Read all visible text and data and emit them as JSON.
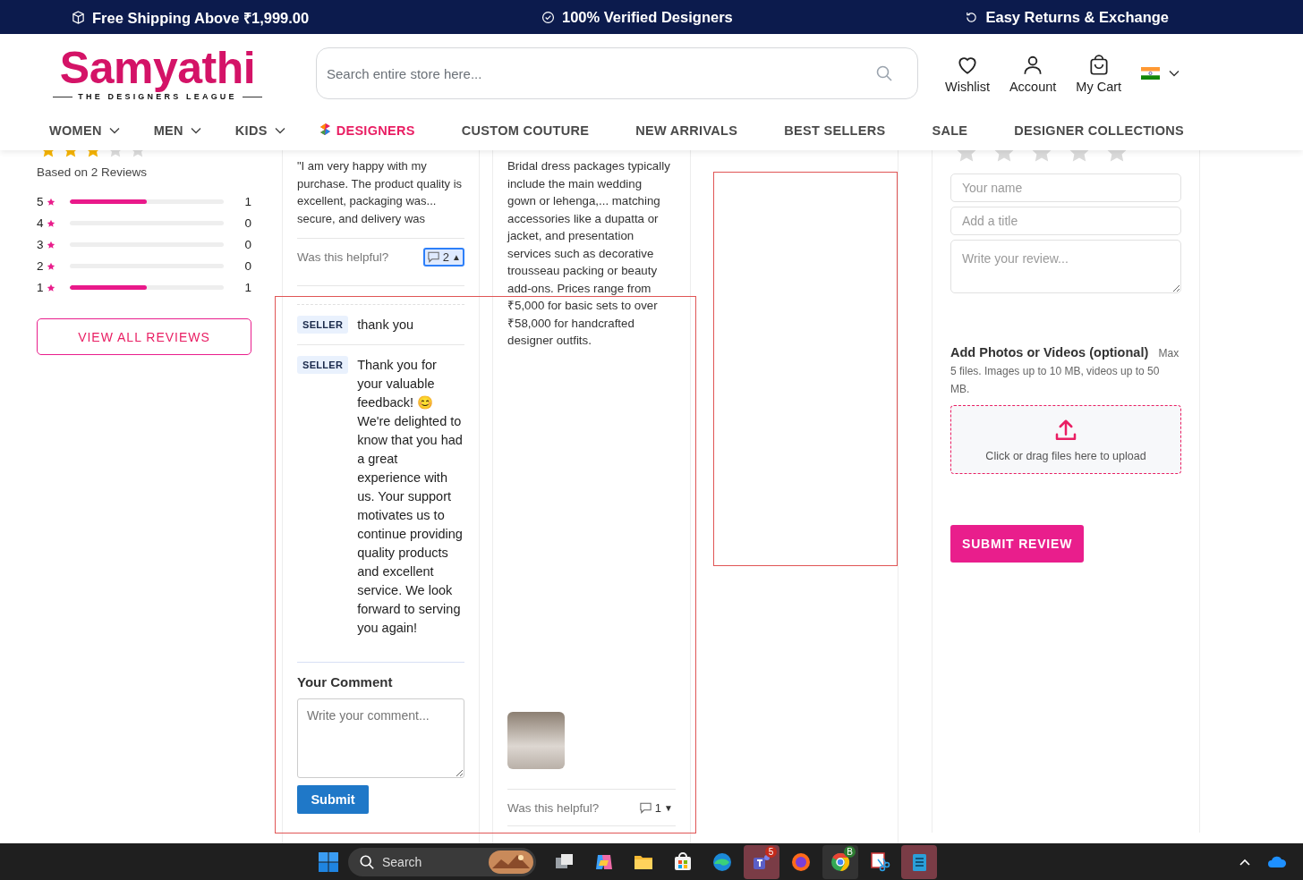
{
  "top_bar": [
    {
      "kind": "box",
      "text": "Free Shipping Above ₹1,999.00"
    },
    {
      "kind": "check",
      "text": "100% Verified Designers"
    },
    {
      "kind": "returns",
      "text": "Easy Returns & Exchange"
    }
  ],
  "header": {
    "logo": {
      "name": "Samyathi",
      "tagline": "THE DESIGNERS LEAGUE"
    },
    "search": {
      "placeholder": "Search entire store here..."
    },
    "actions": [
      {
        "kind": "heart",
        "label": "Wishlist"
      },
      {
        "kind": "person",
        "label": "Account"
      },
      {
        "kind": "bag",
        "label": "My Cart"
      }
    ]
  },
  "nav": [
    {
      "label": "WOMEN",
      "dropdown": true,
      "highlighted": false
    },
    {
      "label": "MEN",
      "dropdown": true,
      "highlighted": false
    },
    {
      "label": "KIDS",
      "dropdown": true,
      "highlighted": false
    },
    {
      "label": "DESIGNERS",
      "dropdown": false,
      "highlighted": true
    },
    {
      "label": "CUSTOM COUTURE",
      "dropdown": false,
      "highlighted": false
    },
    {
      "label": "NEW ARRIVALS",
      "dropdown": false,
      "highlighted": false
    },
    {
      "label": "BEST SELLERS",
      "dropdown": false,
      "highlighted": false
    },
    {
      "label": "SALE",
      "dropdown": false,
      "highlighted": false
    },
    {
      "label": "DESIGNER COLLECTIONS",
      "dropdown": false,
      "highlighted": false
    }
  ],
  "summary": {
    "stars": 3,
    "based_on": "Based on 2 Reviews",
    "breakdown": [
      {
        "label": "5",
        "level": 0.5,
        "count": "1"
      },
      {
        "label": "4",
        "level": 0,
        "count": "0"
      },
      {
        "label": "3",
        "level": 0,
        "count": "0"
      },
      {
        "label": "2",
        "level": 0,
        "count": "0"
      },
      {
        "label": "1",
        "level": 0.5,
        "count": "1"
      }
    ],
    "view_all": "VIEW ALL REVIEWS"
  },
  "reviews": [
    {
      "body": "\"I am very happy with my purchase. The product quality is excellent, packaging was... secure, and delivery was",
      "helpful": "Was this helpful?",
      "votes": "2",
      "vote_arrow": "▲",
      "expanded": true,
      "replies": [
        {
          "badge": "SELLER",
          "text": "thank you"
        },
        {
          "badge": "SELLER",
          "text": "Thank you for your valuable feedback! 😊 We're delighted to know that you had a great experience with us. Your support motivates us to continue providing quality products and excellent service. We look forward to serving you again!"
        }
      ],
      "comment": {
        "heading": "Your Comment",
        "placeholder": "Write your comment...",
        "submit": "Submit"
      }
    },
    {
      "body": "Bridal dress packages typically include the main wedding gown or lehenga,... matching accessories like a dupatta or jacket, and presentation services such as decorative trousseau packing or beauty add-ons. Prices range from ₹5,000 for basic sets to over ₹58,000 for handcrafted designer outfits.",
      "photo": true,
      "helpful": "Was this helpful?",
      "votes": "1",
      "vote_arrow": "▼",
      "expanded": false
    }
  ],
  "form": {
    "stars": 0,
    "name_placeholder": "Your name",
    "title_placeholder": "Add a title",
    "review_placeholder": "Write your review...",
    "upload_text": "**Add Photos or Videos (optional)** Max 5 files. Images up to 10 MB, videos up to 50 MB.",
    "dropzone": "Click or drag files here to upload",
    "submit": "SUBMIT REVIEW"
  },
  "annotation_frames": [
    {
      "kind": "outline"
    },
    {
      "kind": "outline"
    }
  ],
  "taskbar": {
    "search": "Search",
    "apps": [
      {
        "kind": "taskview"
      },
      {
        "kind": "copilot"
      },
      {
        "kind": "files"
      },
      {
        "kind": "store"
      },
      {
        "kind": "edge"
      },
      {
        "kind": "teams",
        "badge": "5"
      },
      {
        "kind": "firefox"
      },
      {
        "kind": "chrome",
        "badge": "B"
      },
      {
        "kind": "snip"
      },
      {
        "kind": "notepad"
      }
    ]
  }
}
